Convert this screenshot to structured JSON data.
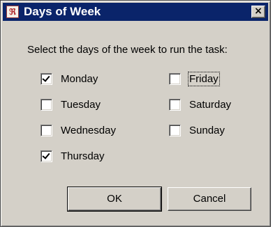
{
  "window": {
    "title": "Days of Week",
    "app_icon": "app-icon",
    "close_glyph": "×"
  },
  "instruction": "Select the days of the week to run the task:",
  "days": [
    {
      "label": "Monday",
      "checked": true
    },
    {
      "label": "Tuesday",
      "checked": false
    },
    {
      "label": "Wednesday",
      "checked": false
    },
    {
      "label": "Thursday",
      "checked": true
    },
    {
      "label": "Friday",
      "checked": false,
      "focused": true
    },
    {
      "label": "Saturday",
      "checked": false
    },
    {
      "label": "Sunday",
      "checked": false
    }
  ],
  "buttons": {
    "ok": "OK",
    "cancel": "Cancel"
  },
  "colors": {
    "titlebar": "#0a246a",
    "face": "#d4d0c8"
  }
}
